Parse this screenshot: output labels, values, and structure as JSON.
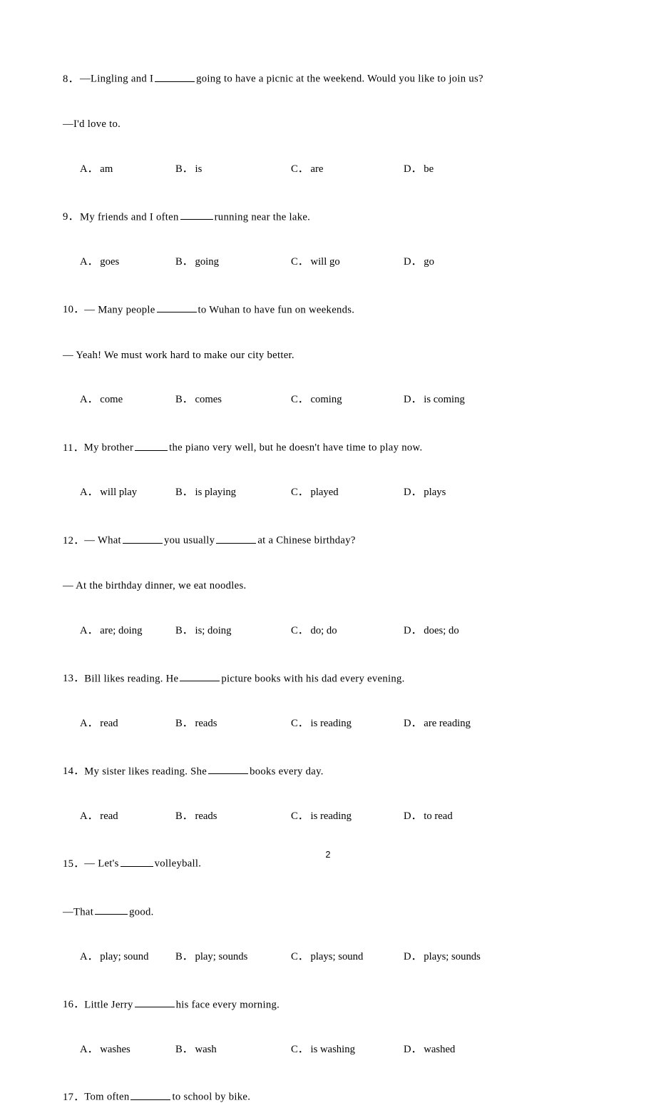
{
  "document": {
    "page_number": "2",
    "type": "english-grammar-multiple-choice-worksheet"
  },
  "questions": [
    {
      "number": "8．",
      "stem_pre": "—Lingling and I",
      "blank": "b-md",
      "stem_post": "going to have a picnic at the weekend. Would you like to join us?",
      "reply": "—I'd love to.",
      "options": [
        {
          "label": "A．",
          "text": "am"
        },
        {
          "label": "B．",
          "text": "is"
        },
        {
          "label": "C．",
          "text": "are"
        },
        {
          "label": "D．",
          "text": "be"
        }
      ]
    },
    {
      "number": "9．",
      "stem_pre": "My friends and I often",
      "blank": "b-sm",
      "stem_post": "running near the lake.",
      "reply": "",
      "options": [
        {
          "label": "A．",
          "text": "goes"
        },
        {
          "label": "B．",
          "text": "going"
        },
        {
          "label": "C．",
          "text": "will go"
        },
        {
          "label": "D．",
          "text": "go"
        }
      ]
    },
    {
      "number": "10．",
      "stem_pre": "— Many people",
      "blank": "b-md",
      "stem_post": "to Wuhan to have fun on weekends.",
      "reply": "— Yeah! We must work hard to make our city better.",
      "options": [
        {
          "label": "A．",
          "text": "come"
        },
        {
          "label": "B．",
          "text": "comes"
        },
        {
          "label": "C．",
          "text": "coming"
        },
        {
          "label": "D．",
          "text": "is coming"
        }
      ]
    },
    {
      "number": "11．",
      "stem_pre": "My brother",
      "blank": "b-sm",
      "stem_post": "the piano very well, but he doesn't have time to play now.",
      "reply": "",
      "options": [
        {
          "label": "A．",
          "text": "will play"
        },
        {
          "label": "B．",
          "text": "is playing"
        },
        {
          "label": "C．",
          "text": "played"
        },
        {
          "label": "D．",
          "text": "plays"
        }
      ]
    },
    {
      "number": "12．",
      "stem_pre": "— What",
      "blank": "b-md",
      "stem_mid": "you usually",
      "blank2": "b-md",
      "stem_post": "at a Chinese birthday?",
      "reply": "— At the birthday dinner, we eat noodles.",
      "options": [
        {
          "label": "A．",
          "text": "are; doing"
        },
        {
          "label": "B．",
          "text": "is; doing"
        },
        {
          "label": "C．",
          "text": "do; do"
        },
        {
          "label": "D．",
          "text": "does; do"
        }
      ]
    },
    {
      "number": "13．",
      "stem_pre": "Bill likes reading. He",
      "blank": "b-md",
      "stem_post": "picture books with his dad every evening.",
      "reply": "",
      "options": [
        {
          "label": "A．",
          "text": "read"
        },
        {
          "label": "B．",
          "text": "reads"
        },
        {
          "label": "C．",
          "text": "is reading"
        },
        {
          "label": "D．",
          "text": "are reading"
        }
      ]
    },
    {
      "number": "14．",
      "stem_pre": "My sister likes reading. She",
      "blank": "b-md",
      "stem_post": "books every day.",
      "reply": "",
      "options": [
        {
          "label": "A．",
          "text": "read"
        },
        {
          "label": "B．",
          "text": "reads"
        },
        {
          "label": "C．",
          "text": "is reading"
        },
        {
          "label": "D．",
          "text": "to read"
        }
      ]
    },
    {
      "number": "15．",
      "stem_pre": "— Let's",
      "blank": "b-sm",
      "stem_post": "volleyball.",
      "reply": "—That",
      "reply_blank": "b-sm",
      "reply_post": "good.",
      "options": [
        {
          "label": "A．",
          "text": "play; sound"
        },
        {
          "label": "B．",
          "text": "play; sounds"
        },
        {
          "label": "C．",
          "text": "plays; sound"
        },
        {
          "label": "D．",
          "text": "plays; sounds"
        }
      ]
    },
    {
      "number": "16．",
      "stem_pre": "Little Jerry",
      "blank": "b-md",
      "stem_post": "his face every morning.",
      "reply": "",
      "options": [
        {
          "label": "A．",
          "text": "washes"
        },
        {
          "label": "B．",
          "text": "wash"
        },
        {
          "label": "C．",
          "text": "is washing"
        },
        {
          "label": "D．",
          "text": "washed"
        }
      ]
    },
    {
      "number": "17．",
      "stem_pre": "Tom often",
      "blank": "b-md",
      "stem_post": "to school by bike.",
      "reply": "",
      "options": []
    }
  ]
}
